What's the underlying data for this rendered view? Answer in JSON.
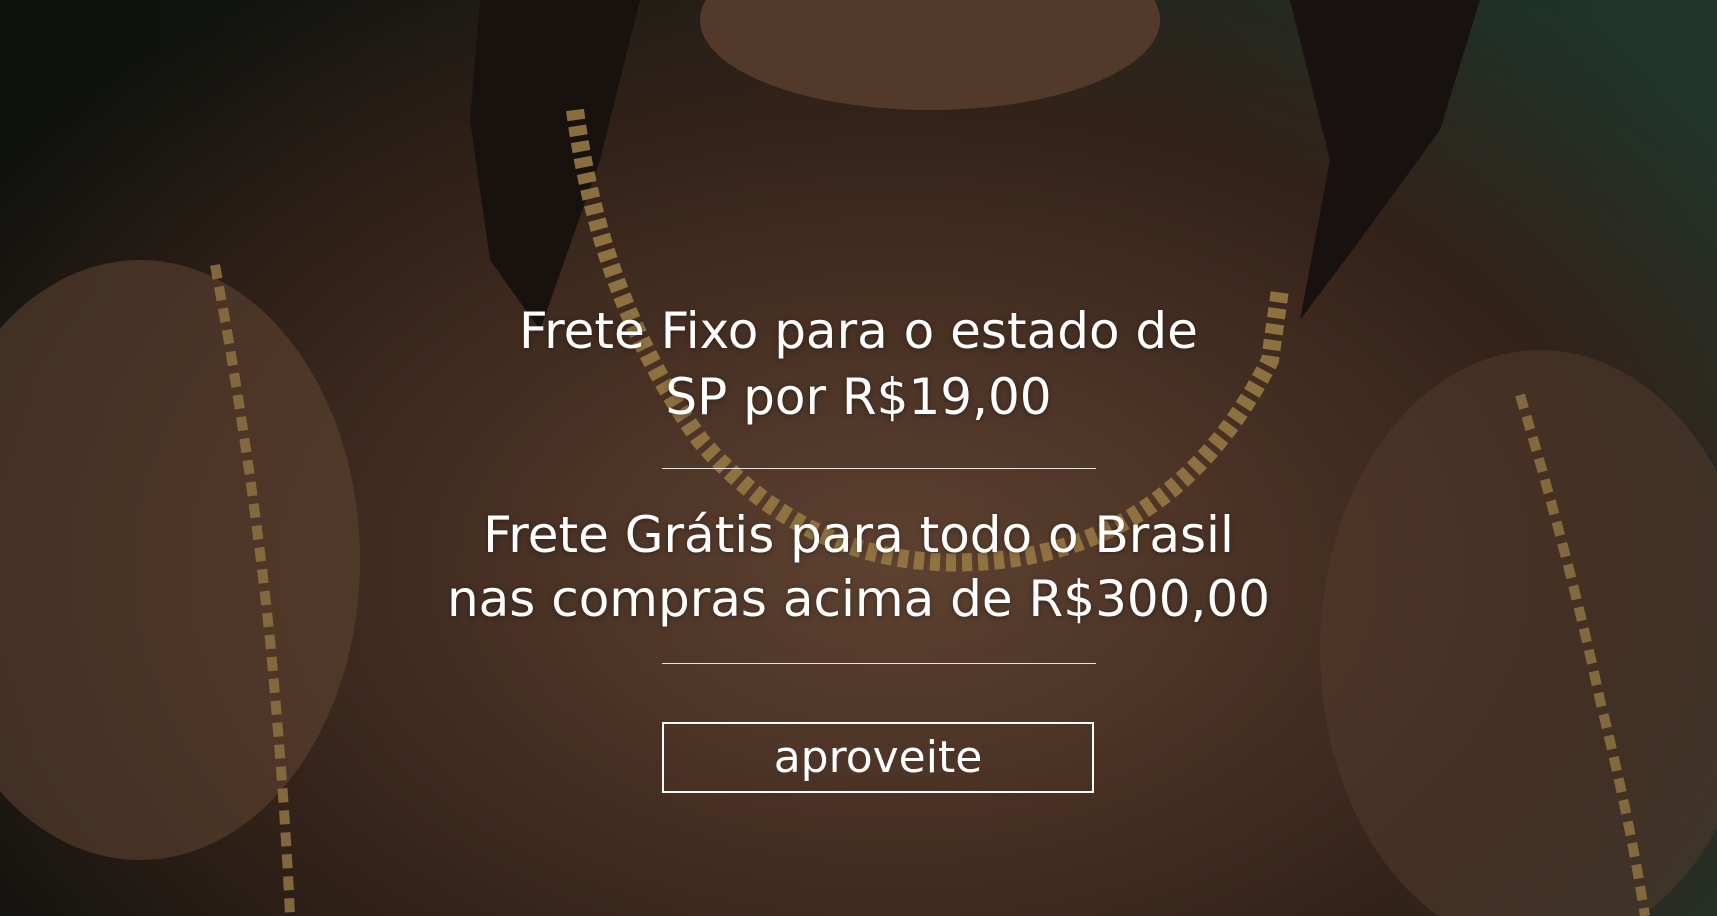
{
  "banner": {
    "fixed_shipping": {
      "line1": "Frete Fixo para o estado de",
      "line2": "SP por R$19,00"
    },
    "free_shipping": {
      "line1": "Frete Grátis para todo o Brasil",
      "line2": "nas compras acima de R$300,00"
    },
    "cta_label": "aproveite"
  },
  "colors": {
    "text": "#ffffff",
    "accent_gold": "#c9a25a",
    "backdrop_green": "#25463a"
  }
}
